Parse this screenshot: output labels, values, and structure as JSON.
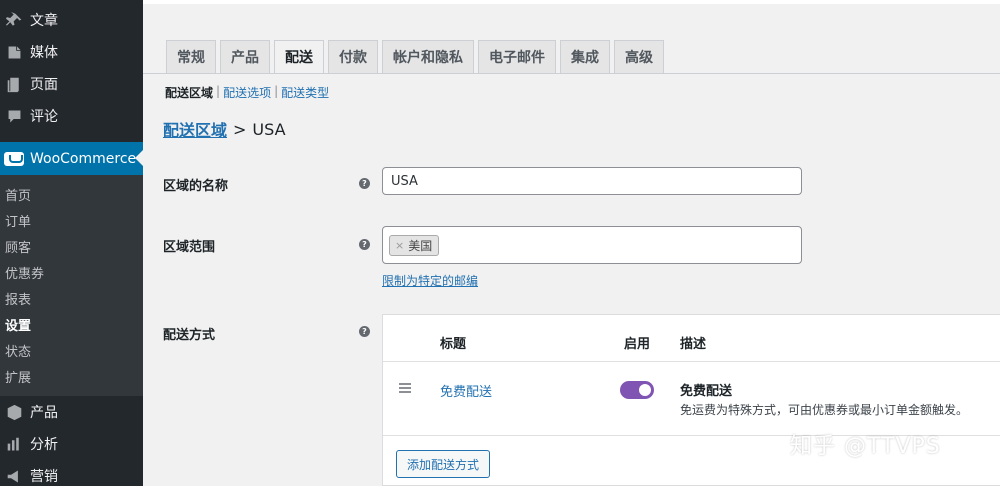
{
  "sidebar": {
    "top_items": [
      {
        "label": "文章",
        "icon": "pin-icon"
      },
      {
        "label": "媒体",
        "icon": "media-icon"
      },
      {
        "label": "页面",
        "icon": "page-icon"
      },
      {
        "label": "评论",
        "icon": "comment-icon"
      }
    ],
    "woocommerce_label": "WooCommerce",
    "sub_items": [
      "首页",
      "订单",
      "顾客",
      "优惠券",
      "报表",
      "设置",
      "状态",
      "扩展"
    ],
    "active_sub": "设置",
    "bottom_items": [
      {
        "label": "产品",
        "icon": "box-icon"
      },
      {
        "label": "分析",
        "icon": "chart-icon"
      },
      {
        "label": "营销",
        "icon": "megaphone-icon"
      }
    ]
  },
  "tabs": [
    "常规",
    "产品",
    "配送",
    "付款",
    "帐户和隐私",
    "电子邮件",
    "集成",
    "高级"
  ],
  "active_tab": "配送",
  "subsubsub": {
    "current": "配送区域",
    "links": [
      "配送选项",
      "配送类型"
    ]
  },
  "breadcrumb": {
    "link": "配送区域",
    "separator": ">",
    "current": "USA"
  },
  "zone_name": {
    "label": "区域的名称",
    "value": "USA"
  },
  "zone_region": {
    "label": "区域范围",
    "chip": "美国",
    "chip_remove": "×",
    "limit_link": "限制为特定的邮编"
  },
  "shipping_methods": {
    "label": "配送方式",
    "col_title": "标题",
    "col_enabled": "启用",
    "col_desc": "描述",
    "row": {
      "title": "免费配送",
      "enabled": true,
      "desc_title": "免费配送",
      "desc": "免运费为特殊方式，可由优惠券或最小订单金额触发。"
    },
    "add_button": "添加配送方式"
  },
  "help_glyph": "?",
  "watermark": "知乎 @TTVPS",
  "colors": {
    "accent": "#0073aa",
    "link": "#2271b1",
    "toggle": "#7f54b3"
  }
}
